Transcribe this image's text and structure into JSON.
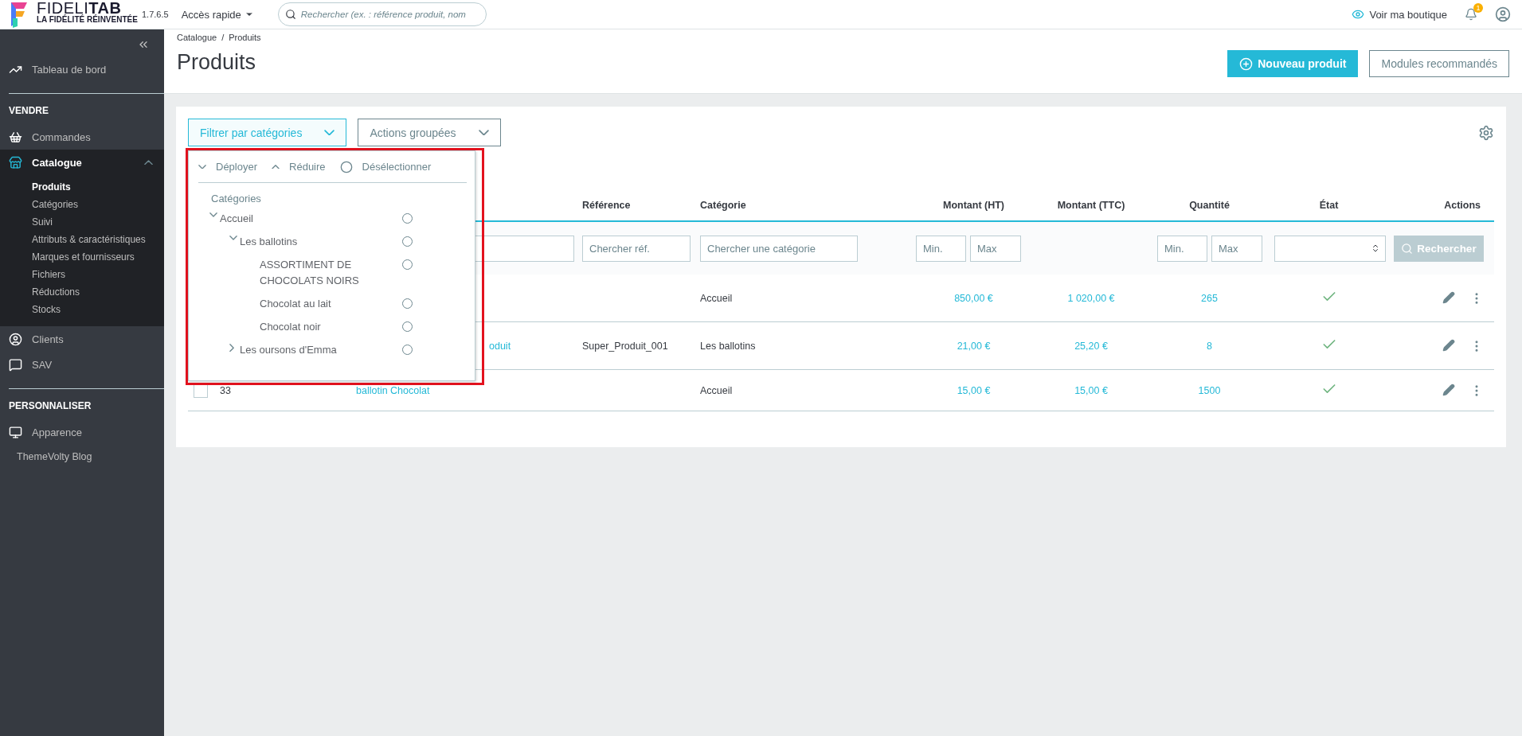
{
  "topbar": {
    "logo_title": "FIDELI**TAB**",
    "logo_tagline": "LA FIDÉLITÉ RÉINVENTÉE",
    "version": "1.7.6.5",
    "quick_access": "Accès rapide",
    "search": {
      "placeholder": "Rechercher (ex. : référence produit, nom"
    },
    "shop_link": "Voir ma boutique",
    "notifications": "1"
  },
  "sidebar": {
    "items": [
      {
        "kind": "link",
        "label": "Tableau de bord",
        "selected": false
      },
      {
        "kind": "heading",
        "label": "VENDRE"
      },
      {
        "kind": "link",
        "label": "Commandes",
        "selected": false
      },
      {
        "kind": "link",
        "label": "Catalogue",
        "selected": true,
        "expanded": true,
        "children": [
          {
            "label": "Produits",
            "selected": true
          },
          {
            "label": "Catégories",
            "selected": false
          },
          {
            "label": "Suivi",
            "selected": false
          },
          {
            "label": "Attributs & caractéristiques",
            "selected": false
          },
          {
            "label": "Marques et fournisseurs",
            "selected": false
          },
          {
            "label": "Fichiers",
            "selected": false
          },
          {
            "label": "Réductions",
            "selected": false
          },
          {
            "label": "Stocks",
            "selected": false
          }
        ]
      },
      {
        "kind": "link",
        "label": "Clients",
        "selected": false
      },
      {
        "kind": "link",
        "label": "SAV",
        "selected": false
      },
      {
        "kind": "heading",
        "label": "PERSONNALISER"
      },
      {
        "kind": "link",
        "label": "Apparence",
        "selected": false
      },
      {
        "kind": "plain",
        "label": "ThemeVolty Blog"
      }
    ]
  },
  "breadcrumb": {
    "items": [
      "Catalogue",
      "Produits"
    ],
    "separator": "/"
  },
  "title": "Produits",
  "header_buttons": [
    {
      "kind": "primary",
      "label": "Nouveau produit"
    },
    {
      "kind": "outline",
      "label": "Modules recommandés"
    }
  ],
  "toolbar": [
    {
      "label": "Filtrer par catégories",
      "selected": true
    },
    {
      "label": "Actions groupées",
      "selected": false
    }
  ],
  "category_dropdown": {
    "actions": [
      "Déployer",
      "Réduire",
      "Désélectionner"
    ],
    "heading": "Catégories",
    "tree": [
      {
        "label": "Accueil",
        "selected": false,
        "expanded": true,
        "children": [
          {
            "label": "Les ballotins",
            "selected": false,
            "expanded": true,
            "children": [
              {
                "label": "ASSORTIMENT DE CHOCOLATS NOIRS",
                "selected": false
              },
              {
                "label": "Chocolat au lait",
                "selected": false
              },
              {
                "label": "Chocolat noir",
                "selected": false
              }
            ]
          },
          {
            "label": "Les oursons d'Emma",
            "selected": false,
            "expanded": false
          }
        ]
      }
    ]
  },
  "table": {
    "columns": [
      {
        "label": "Référence"
      },
      {
        "label": "Catégorie"
      },
      {
        "label": "Montant (HT)"
      },
      {
        "label": "Montant (TTC)"
      },
      {
        "label": "Quantité"
      },
      {
        "label": "État"
      },
      {
        "label": "Actions"
      }
    ],
    "filters": {
      "reference": {
        "placeholder": "Chercher réf."
      },
      "category": {
        "placeholder": "Chercher une catégorie"
      },
      "price_min": {
        "placeholder": "Min."
      },
      "price_max": {
        "placeholder": "Max"
      },
      "qty_min": {
        "placeholder": "Min."
      },
      "qty_max": {
        "placeholder": "Max"
      },
      "search_button": {
        "label": "Rechercher",
        "disabled": true
      }
    },
    "rows": [
      {
        "category": "Accueil",
        "price_ht": "850,00 €",
        "price_ttc": "1 020,00 €",
        "quantity": "265",
        "active": true
      },
      {
        "name": "oduit",
        "name_cut": true,
        "reference": "Super_Produit_001",
        "category": "Les ballotins",
        "price_ht": "21,00 €",
        "price_ttc": "25,20 €",
        "quantity": "8",
        "active": true
      },
      {
        "checked": false,
        "id": "33",
        "name": "ballotin Chocolat",
        "category": "Accueil",
        "price_ht": "15,00 €",
        "price_ttc": "15,00 €",
        "quantity": "1500",
        "active": true
      }
    ]
  }
}
